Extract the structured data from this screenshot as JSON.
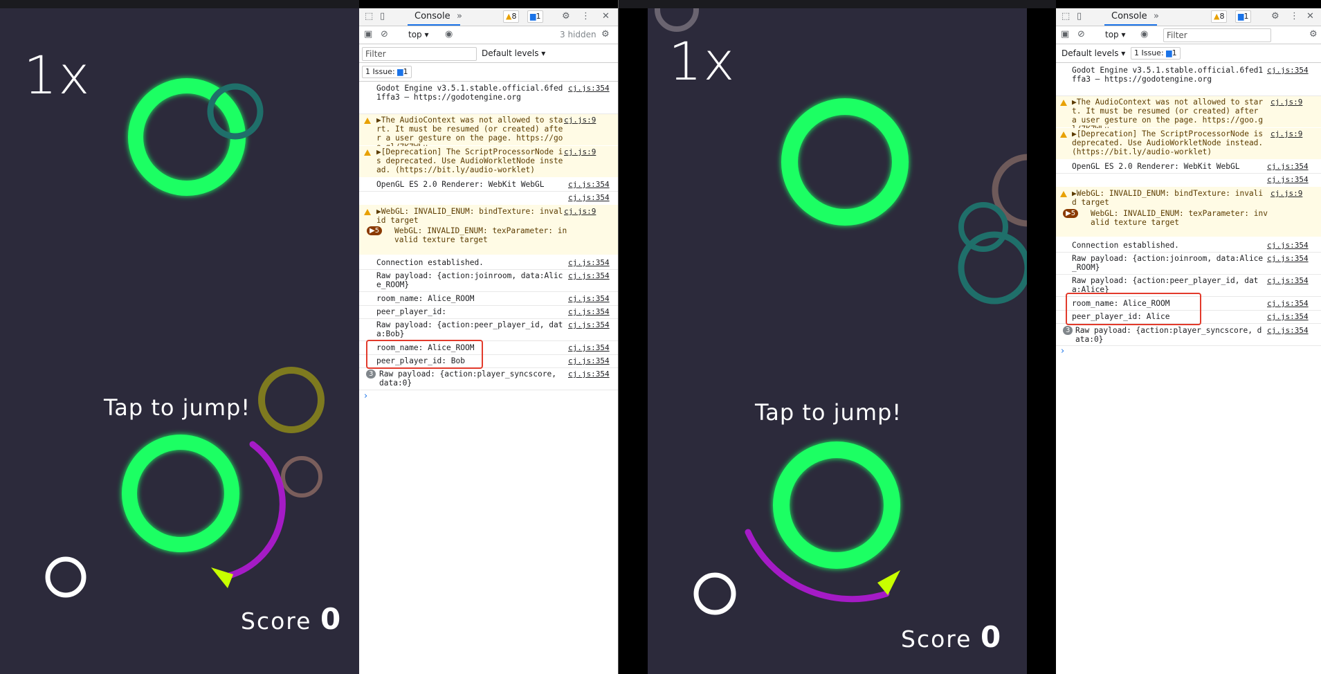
{
  "left": {
    "game": {
      "multiplier": "1x",
      "tap_hint": "Tap to jump!",
      "score_label": "Score",
      "score_value": "0"
    },
    "devtools": {
      "tab_console": "Console",
      "warn_count": "8",
      "info_count": "1",
      "context": "top",
      "hidden_count": "3 hidden",
      "filter_placeholder": "Filter",
      "default_levels": "Default levels",
      "issue_label": "1 Issue:",
      "issue_count": "1",
      "messages": [
        {
          "text": "Godot Engine v3.5.1.stable.official.6fed1ffa3 – https://godotengine.org",
          "src": "cj.js:354"
        },
        {
          "text": "▶The AudioContext was not allowed to start. It must be resumed (or created) after a user gesture on the page. https://goo.gl/7K7WLu",
          "src": "cj.js:9"
        },
        {
          "text": "▶[Deprecation] The ScriptProcessorNode is deprecated. Use AudioWorkletNode instead. (https://bit.ly/audio-worklet)",
          "src": "cj.js:9"
        },
        {
          "text": "OpenGL ES 2.0 Renderer: WebKit WebGL",
          "src": "cj.js:354"
        },
        {
          "text": "",
          "src": "cj.js:354"
        },
        {
          "text": "▶WebGL: INVALID_ENUM: bindTexture: invalid target",
          "src": "cj.js:9"
        },
        {
          "text": "WebGL: INVALID_ENUM: texParameter: invalid texture target",
          "src": "",
          "count": "▶5"
        },
        {
          "text": "Connection established.",
          "src": "cj.js:354"
        },
        {
          "text": "Raw payload: {action:joinroom, data:Alice_ROOM}",
          "src": "cj.js:354"
        },
        {
          "text": "room_name: Alice_ROOM",
          "src": "cj.js:354"
        },
        {
          "text": "peer_player_id:",
          "src": "cj.js:354"
        },
        {
          "text": "Raw payload: {action:peer_player_id, data:Bob}",
          "src": "cj.js:354"
        },
        {
          "text": "room_name: Alice_ROOM",
          "src": "cj.js:354"
        },
        {
          "text": "peer_player_id: Bob",
          "src": "cj.js:354"
        },
        {
          "text": "Raw payload: {action:player_syncscore, data:0}",
          "src": "cj.js:354",
          "count": "3"
        }
      ]
    }
  },
  "right": {
    "game": {
      "multiplier": "1x",
      "tap_hint": "Tap to jump!",
      "score_label": "Score",
      "score_value": "0"
    },
    "devtools": {
      "tab_console": "Console",
      "warn_count": "8",
      "info_count": "1",
      "context": "top",
      "filter_placeholder": "Filter",
      "default_levels": "Default levels",
      "issue_label": "1 Issue:",
      "issue_count": "1",
      "messages": [
        {
          "text": "Godot Engine v3.5.1.stable.official.6fed1ffa3 – https://godotengine.org",
          "src": "cj.js:354"
        },
        {
          "text": "▶The AudioContext was not allowed to start. It must be resumed (or created) after a user gesture on the page. https://goo.gl/7K7WLu",
          "src": "cj.js:9"
        },
        {
          "text": "▶[Deprecation] The ScriptProcessorNode is deprecated. Use AudioWorkletNode instead. (https://bit.ly/audio-worklet)",
          "src": "cj.js:9"
        },
        {
          "text": "OpenGL ES 2.0 Renderer: WebKit WebGL",
          "src": "cj.js:354"
        },
        {
          "text": "",
          "src": "cj.js:354"
        },
        {
          "text": "▶WebGL: INVALID_ENUM: bindTexture: invalid target",
          "src": "cj.js:9"
        },
        {
          "text": "WebGL: INVALID_ENUM: texParameter: invalid texture target",
          "src": "",
          "count": "▶5"
        },
        {
          "text": "Connection established.",
          "src": "cj.js:354"
        },
        {
          "text": "Raw payload: {action:joinroom, data:Alice_ROOM}",
          "src": "cj.js:354"
        },
        {
          "text": "Raw payload: {action:peer_player_id, data:Alice}",
          "src": "cj.js:354"
        },
        {
          "text": "room_name: Alice_ROOM",
          "src": "cj.js:354"
        },
        {
          "text": "peer_player_id: Alice",
          "src": "cj.js:354"
        },
        {
          "text": "Raw payload: {action:player_syncscore, data:0}",
          "src": "cj.js:354",
          "count": "3"
        }
      ]
    }
  },
  "colors": {
    "game_bg": "#2c2a3b",
    "ring_green": "#1aff63",
    "arc_purple": "#b31ad6",
    "arrow_yellow": "#c8ff00",
    "highlight_red": "#e23a2b",
    "warn_bg": "#fffbe5"
  }
}
